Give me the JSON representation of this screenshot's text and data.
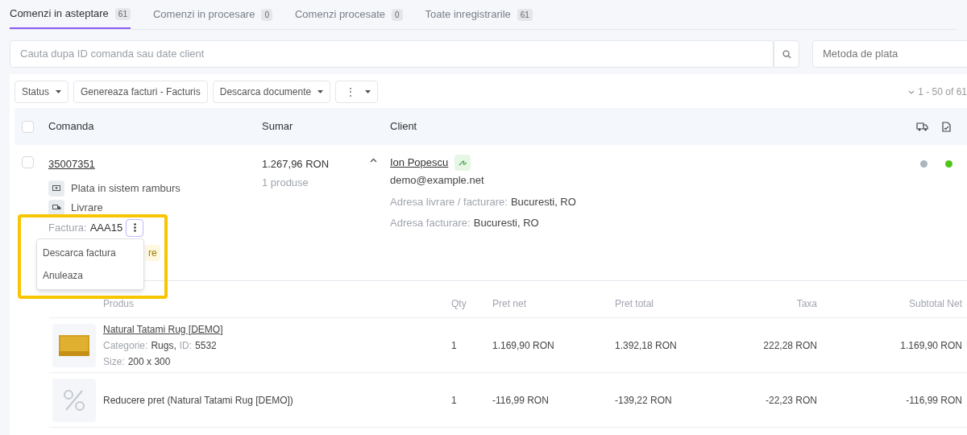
{
  "tabs": [
    {
      "label": "Comenzi in asteptare",
      "count": "61",
      "selected": true
    },
    {
      "label": "Comenzi in procesare",
      "count": "0",
      "selected": false
    },
    {
      "label": "Comenzi procesate",
      "count": "0",
      "selected": false
    },
    {
      "label": "Toate inregistrarile",
      "count": "61",
      "selected": false
    }
  ],
  "search": {
    "placeholder": "Cauta dupa ID comanda sau date client"
  },
  "payment_filter": {
    "placeholder": "Metoda de plata"
  },
  "toolbar": [
    {
      "label": "Status",
      "caret": true
    },
    {
      "label": "Genereaza facturi - Facturis",
      "caret": false
    },
    {
      "label": "Descarca documente",
      "caret": true
    },
    {
      "label": "⋮",
      "caret": true
    }
  ],
  "pagination": "1 - 50 of 61",
  "table": {
    "select_all_checked": false,
    "columns": [
      "Comanda",
      "Sumar",
      "Client"
    ],
    "order": {
      "checked": false,
      "id": "35007351",
      "payment": "Plata in sistem ramburs",
      "shipping": "Livrare",
      "invoice_label": "Factura:",
      "invoice": "AAA15",
      "badge": "re",
      "total": "1.267,96 RON",
      "products_count": "1 produse",
      "expanded": true,
      "client_name": "Ion Popescu",
      "email": "demo@example.net",
      "addresses": [
        {
          "label": "Adresa livrare / facturare:",
          "value": "Bucuresti, RO"
        },
        {
          "label": "Adresa facturare:",
          "value": "Bucuresti, RO"
        }
      ],
      "status_dots": [
        {
          "color": "#adb5bd"
        },
        {
          "color": "#52c41a"
        }
      ]
    }
  },
  "invoice_menu": [
    "Descarca factura",
    "Anuleaza"
  ],
  "products": {
    "columns": [
      "Produs",
      "Qty",
      "Pret net",
      "Pret total",
      "Taxa",
      "Subtotal Net"
    ],
    "rows": [
      {
        "kind": "product",
        "name": "Natural Tatami Rug [DEMO]",
        "category_label": "Categorie:",
        "category": "Rugs,",
        "id_label": "ID:",
        "id": "5532",
        "size_label": "Size:",
        "size": "200 x 300",
        "qty": "1",
        "net": "1.169,90 RON",
        "total": "1.392,18 RON",
        "tax": "222,28 RON",
        "subtotal": "1.169,90 RON"
      },
      {
        "kind": "discount",
        "name": "Reducere pret (Natural Tatami Rug [DEMO])",
        "qty": "1",
        "net": "-116,99 RON",
        "total": "-139,22 RON",
        "tax": "-22,23 RON",
        "subtotal": "-116,99 RON"
      }
    ]
  }
}
